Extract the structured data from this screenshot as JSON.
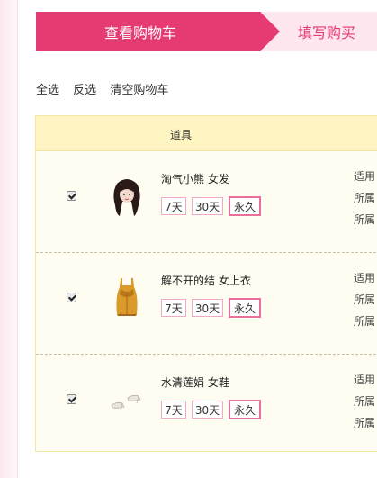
{
  "steps": [
    {
      "label": "查看购物车",
      "active": true
    },
    {
      "label": "填写购买",
      "active": false
    }
  ],
  "actions": [
    "全选",
    "反选",
    "清空购物车"
  ],
  "table": {
    "header_item": "道具",
    "rows": [
      {
        "name": "淘气小熊  女发",
        "checked": true,
        "options": [
          "7天",
          "30天",
          "永久"
        ],
        "selected": "永久",
        "meta": [
          "适用",
          "所属",
          "所属"
        ],
        "icon": "hair-icon"
      },
      {
        "name": "解不开的结  女上衣",
        "checked": true,
        "options": [
          "7天",
          "30天",
          "永久"
        ],
        "selected": "永久",
        "meta": [
          "适用",
          "所属",
          "所属"
        ],
        "icon": "top-icon"
      },
      {
        "name": "水清莲娟  女鞋",
        "checked": true,
        "options": [
          "7天",
          "30天",
          "永久"
        ],
        "selected": "永久",
        "meta": [
          "适用",
          "所属",
          "所属"
        ],
        "icon": "shoes-icon"
      }
    ]
  },
  "colors": {
    "accent": "#e63a73",
    "step_inactive_bg": "#fde6ee",
    "table_bg": "#fffdf1",
    "header_bg": "#fff5c3",
    "option_border": "#f2a9c3"
  }
}
